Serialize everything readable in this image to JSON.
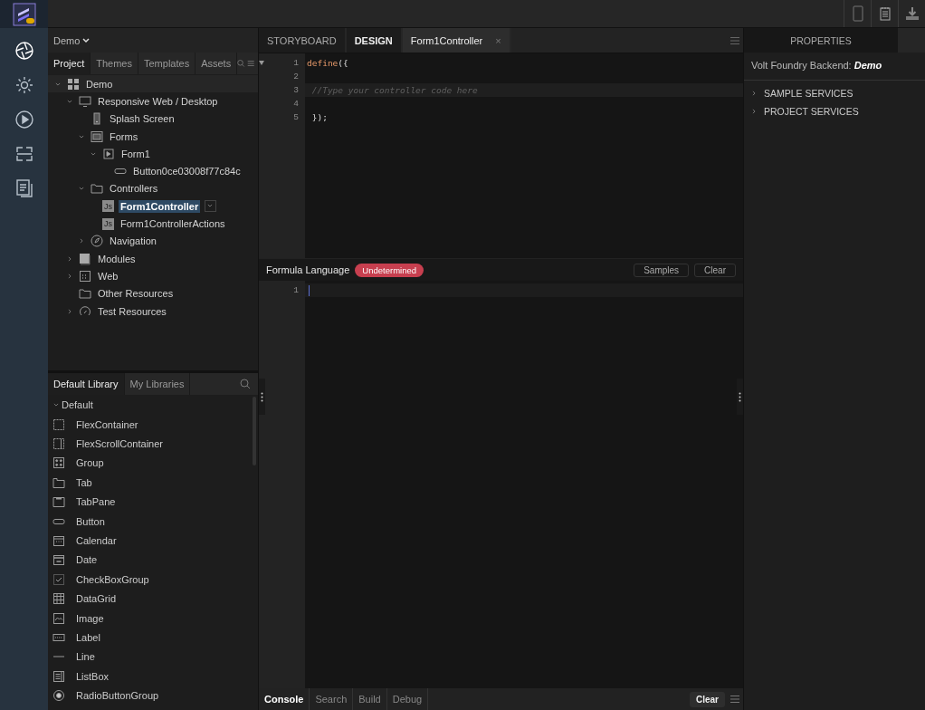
{
  "project_menu": {
    "label": "Demo"
  },
  "project_tabs": [
    {
      "label": "Project",
      "selected": true
    },
    {
      "label": "Themes",
      "selected": false
    },
    {
      "label": "Templates",
      "selected": false
    },
    {
      "label": "Assets",
      "selected": false
    }
  ],
  "tree": [
    {
      "label": "Demo",
      "kind": "app",
      "selected": false,
      "expanded": true,
      "children": [
        {
          "label": "Responsive Web / Desktop",
          "kind": "monitor",
          "selected": false,
          "expanded": true,
          "children": [
            {
              "label": "Splash Screen",
              "kind": "phone",
              "selected": false
            },
            {
              "label": "Forms",
              "kind": "forms",
              "selected": false,
              "expanded": true,
              "children": [
                {
                  "label": "Form1",
                  "kind": "form",
                  "selected": false,
                  "expanded": true,
                  "children": [
                    {
                      "label": "Button0ce03008f77c84c",
                      "kind": "button",
                      "selected": false
                    }
                  ]
                }
              ]
            },
            {
              "label": "Controllers",
              "kind": "folder",
              "selected": false,
              "expanded": true,
              "children": [
                {
                  "label": "Form1Controller",
                  "kind": "js",
                  "icon_text": "Js",
                  "selected": true
                },
                {
                  "label": "Form1ControllerActions",
                  "kind": "js",
                  "icon_text": "Js",
                  "selected": false
                }
              ]
            },
            {
              "label": "Navigation",
              "kind": "compass",
              "selected": false,
              "expanded": false
            }
          ]
        },
        {
          "label": "Modules",
          "kind": "modules",
          "selected": false,
          "expanded": false
        },
        {
          "label": "Web",
          "kind": "web",
          "selected": false,
          "expanded": false
        },
        {
          "label": "Other Resources",
          "kind": "folder",
          "selected": false
        },
        {
          "label": "Test Resources",
          "kind": "gauge",
          "selected": false,
          "expanded": false
        }
      ]
    }
  ],
  "library_tabs": [
    {
      "label": "Default Library",
      "selected": true
    },
    {
      "label": "My Libraries",
      "selected": false
    }
  ],
  "library": {
    "group": "Default",
    "expanded": true,
    "items": [
      {
        "label": "FlexContainer",
        "kind": "frame"
      },
      {
        "label": "FlexScrollContainer",
        "kind": "scrollframe"
      },
      {
        "label": "Group",
        "kind": "group"
      },
      {
        "label": "Tab",
        "kind": "tab"
      },
      {
        "label": "TabPane",
        "kind": "tabpane"
      },
      {
        "label": "Button",
        "kind": "button"
      },
      {
        "label": "Calendar",
        "kind": "calendar"
      },
      {
        "label": "Date",
        "kind": "date"
      },
      {
        "label": "CheckBoxGroup",
        "kind": "check"
      },
      {
        "label": "DataGrid",
        "kind": "grid"
      },
      {
        "label": "Image",
        "kind": "image"
      },
      {
        "label": "Label",
        "kind": "label"
      },
      {
        "label": "Line",
        "kind": "line"
      },
      {
        "label": "ListBox",
        "kind": "listbox"
      },
      {
        "label": "RadioButtonGroup",
        "kind": "radio"
      }
    ]
  },
  "editor_tabs": [
    {
      "label": "STORYBOARD",
      "selected": false
    },
    {
      "label": "DESIGN",
      "selected": false
    },
    {
      "label": "Form1Controller",
      "selected": true,
      "close": "×"
    }
  ],
  "code": [
    {
      "number": "1",
      "folded": false,
      "tokens": [
        {
          "text": "define",
          "kind": "keyword"
        },
        {
          "text": "({",
          "kind": "plain"
        }
      ]
    },
    {
      "number": "2"
    },
    {
      "number": "3",
      "tokens": [
        {
          "text": " //Type your controller code here",
          "kind": "comment"
        }
      ]
    },
    {
      "number": "4"
    },
    {
      "number": "5",
      "tokens": [
        {
          "text": " });",
          "kind": "plain"
        }
      ]
    }
  ],
  "formula": {
    "title": "Formula Language",
    "badge": "Undetermined",
    "buttons": [
      "Samples",
      "Clear"
    ],
    "lines": [
      "1"
    ]
  },
  "console_tabs": [
    {
      "label": "Console",
      "selected": true
    },
    {
      "label": "Search",
      "selected": false
    },
    {
      "label": "Build",
      "selected": false
    },
    {
      "label": "Debug",
      "selected": false
    }
  ],
  "console_clear": "Clear",
  "properties": {
    "tab": "PROPERTIES",
    "backend": "Volt Foundry Backend: **Demo**",
    "sections": [
      {
        "label": "SAMPLE SERVICES",
        "expanded": false
      },
      {
        "label": "PROJECT SERVICES",
        "expanded": false
      }
    ]
  }
}
